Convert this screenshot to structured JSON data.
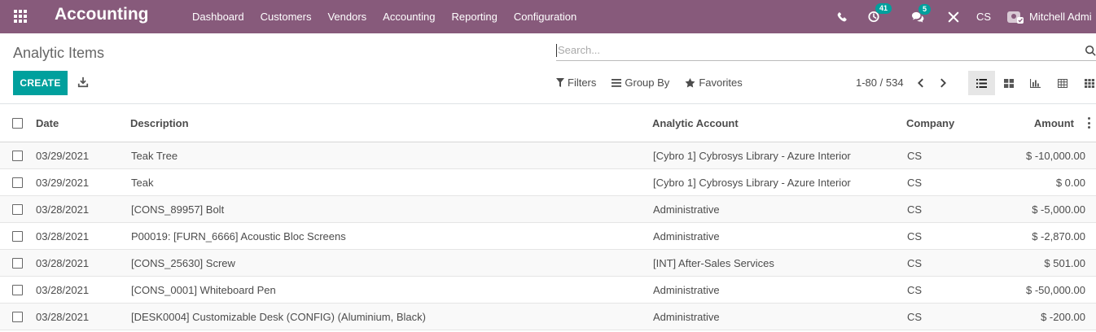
{
  "navbar": {
    "brand": "Accounting",
    "menu": [
      "Dashboard",
      "Customers",
      "Vendors",
      "Accounting",
      "Reporting",
      "Configuration"
    ],
    "activity_count": "41",
    "messages_count": "5",
    "company": "CS",
    "user": "Mitchell Admi"
  },
  "control_panel": {
    "title": "Analytic Items",
    "search_placeholder": "Search...",
    "create_label": "CREATE",
    "filters_label": "Filters",
    "group_by_label": "Group By",
    "favorites_label": "Favorites",
    "pager": "1-80 / 534"
  },
  "table": {
    "headers": {
      "date": "Date",
      "description": "Description",
      "account": "Analytic Account",
      "company": "Company",
      "amount": "Amount"
    },
    "rows": [
      {
        "date": "03/29/2021",
        "description": "Teak Tree",
        "account": "[Cybro 1] Cybrosys Library - Azure Interior",
        "company": "CS",
        "amount": "$ -10,000.00"
      },
      {
        "date": "03/29/2021",
        "description": "Teak",
        "account": "[Cybro 1] Cybrosys Library - Azure Interior",
        "company": "CS",
        "amount": "$ 0.00"
      },
      {
        "date": "03/28/2021",
        "description": "[CONS_89957] Bolt",
        "account": "Administrative",
        "company": "CS",
        "amount": "$ -5,000.00"
      },
      {
        "date": "03/28/2021",
        "description": "P00019: [FURN_6666] Acoustic Bloc Screens",
        "account": "Administrative",
        "company": "CS",
        "amount": "$ -2,870.00"
      },
      {
        "date": "03/28/2021",
        "description": "[CONS_25630] Screw",
        "account": "[INT] After-Sales Services",
        "company": "CS",
        "amount": "$ 501.00"
      },
      {
        "date": "03/28/2021",
        "description": "[CONS_0001] Whiteboard Pen",
        "account": "Administrative",
        "company": "CS",
        "amount": "$ -50,000.00"
      },
      {
        "date": "03/28/2021",
        "description": "[DESK0004] Customizable Desk (CONFIG) (Aluminium, Black)",
        "account": "Administrative",
        "company": "CS",
        "amount": "$ -200.00"
      }
    ]
  },
  "colors": {
    "navbar": "#875a7b",
    "primary": "#00a09d"
  }
}
